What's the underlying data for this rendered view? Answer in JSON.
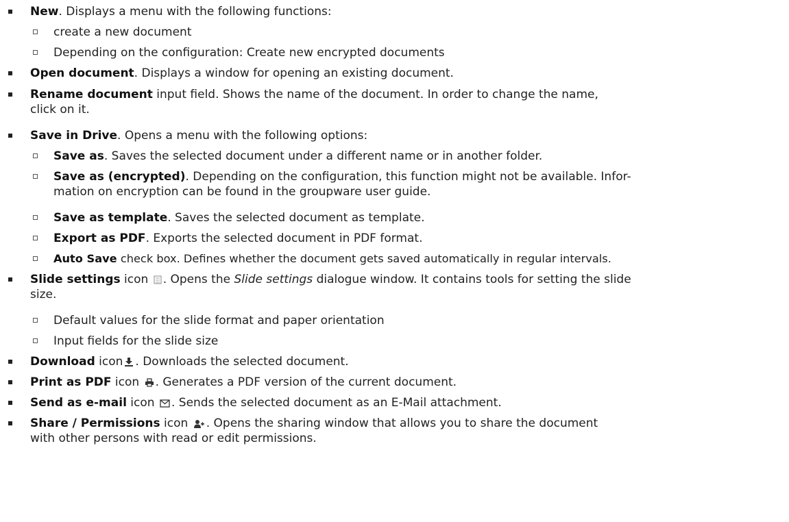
{
  "items": [
    {
      "bold": "New",
      "text": ". Displays a menu with the following functions:"
    },
    {
      "sub": "create a new document"
    },
    {
      "sub": "Depending on the configuration: Create new encrypted documents"
    },
    {
      "bold": "Open document",
      "text": ". Displays a window for opening an existing document."
    },
    {
      "bold": "Rename document",
      "text": " input field. Shows the name of the document. In order to change the name,",
      "cont": "click on it."
    },
    {
      "bold": "Save in Drive",
      "text": ". Opens a menu with the following options:"
    },
    {
      "subbold": "Save as",
      "text": ". Saves the selected document under a different name or in another folder."
    },
    {
      "subbold": "Save as (encrypted)",
      "text": ". Depending on the configuration, this function might not be available. Infor-",
      "cont": "mation on encryption can be found in the groupware user guide."
    },
    {
      "subbold": "Save as template",
      "text": ". Saves the selected document as template."
    },
    {
      "subbold": "Export as PDF",
      "text": ". Exports the selected document in PDF format."
    },
    {
      "subbold": "Auto Save",
      "text": " check box. Defines whether the document gets saved automatically in regular intervals."
    },
    {
      "bold": "Slide settings",
      "pre": " icon ",
      "post": ". Opens the ",
      "ital": "Slide settings",
      "text": " dialogue window. It contains tools for setting the slide",
      "cont": "size."
    },
    {
      "sub": "Default values for the slide format and paper orientation"
    },
    {
      "sub": "Input fields for the slide size"
    },
    {
      "bold": "Download",
      "pre": " icon",
      "post": ". Downloads the selected document."
    },
    {
      "bold": "Print as PDF",
      "pre": " icon ",
      "post": ". Generates a PDF version of the current document."
    },
    {
      "bold": "Send as e-mail",
      "pre": " icon ",
      "post": ". Sends the selected document as an E-Mail attachment."
    },
    {
      "bold": "Share / Permissions",
      "pre": " icon ",
      "post": ". Opens the sharing window that allows you to share the document",
      "cont": "with other persons with read or edit permissions."
    }
  ]
}
